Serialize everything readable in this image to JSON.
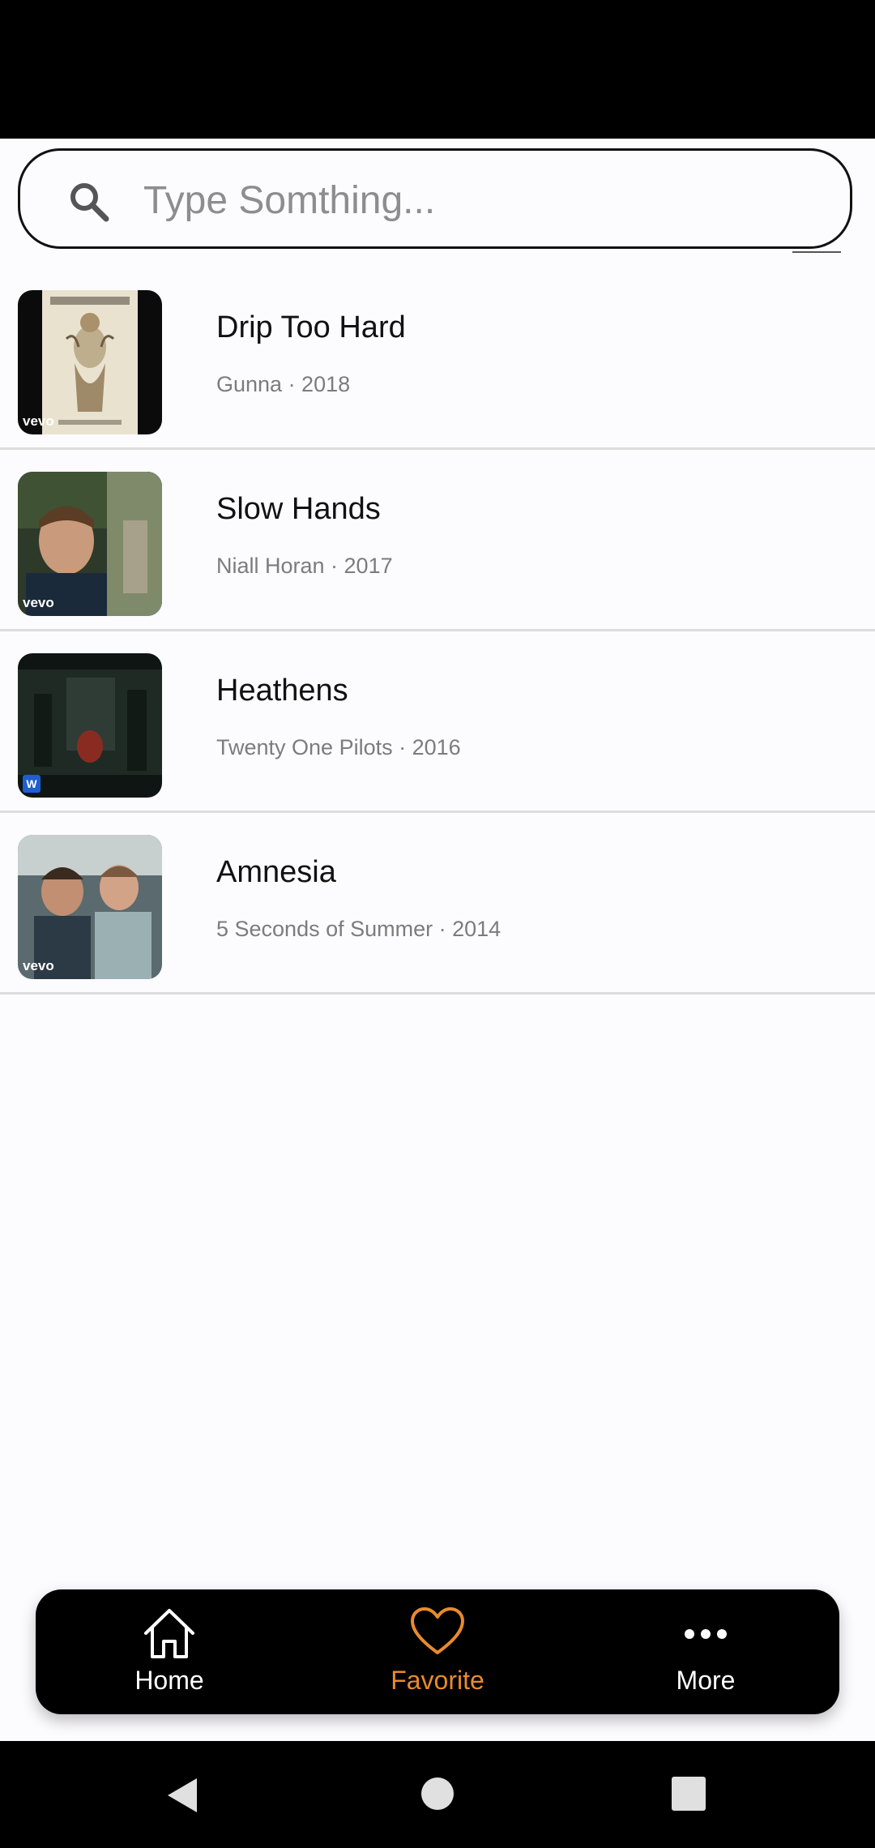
{
  "search": {
    "placeholder": "Type Somthing..."
  },
  "songs": [
    {
      "title": "Drip Too Hard",
      "subtitle": "Gunna · 2018",
      "thumb_badge": "vevo"
    },
    {
      "title": "Slow Hands",
      "subtitle": "Niall Horan · 2017",
      "thumb_badge": "vevo"
    },
    {
      "title": "Heathens",
      "subtitle": "Twenty One Pilots · 2016",
      "thumb_badge": "W"
    },
    {
      "title": "Amnesia",
      "subtitle": "5 Seconds of Summer · 2014",
      "thumb_badge": "vevo"
    }
  ],
  "nav": {
    "items": [
      {
        "label": "Home",
        "icon": "home-icon",
        "active": false
      },
      {
        "label": "Favorite",
        "icon": "heart-icon",
        "active": true
      },
      {
        "label": "More",
        "icon": "more-icon",
        "active": false
      }
    ],
    "active_color": "#e88a2d",
    "inactive_color": "#ffffff"
  },
  "system_nav": {
    "icons": [
      "back-icon",
      "home-circle-icon",
      "recents-icon"
    ]
  }
}
